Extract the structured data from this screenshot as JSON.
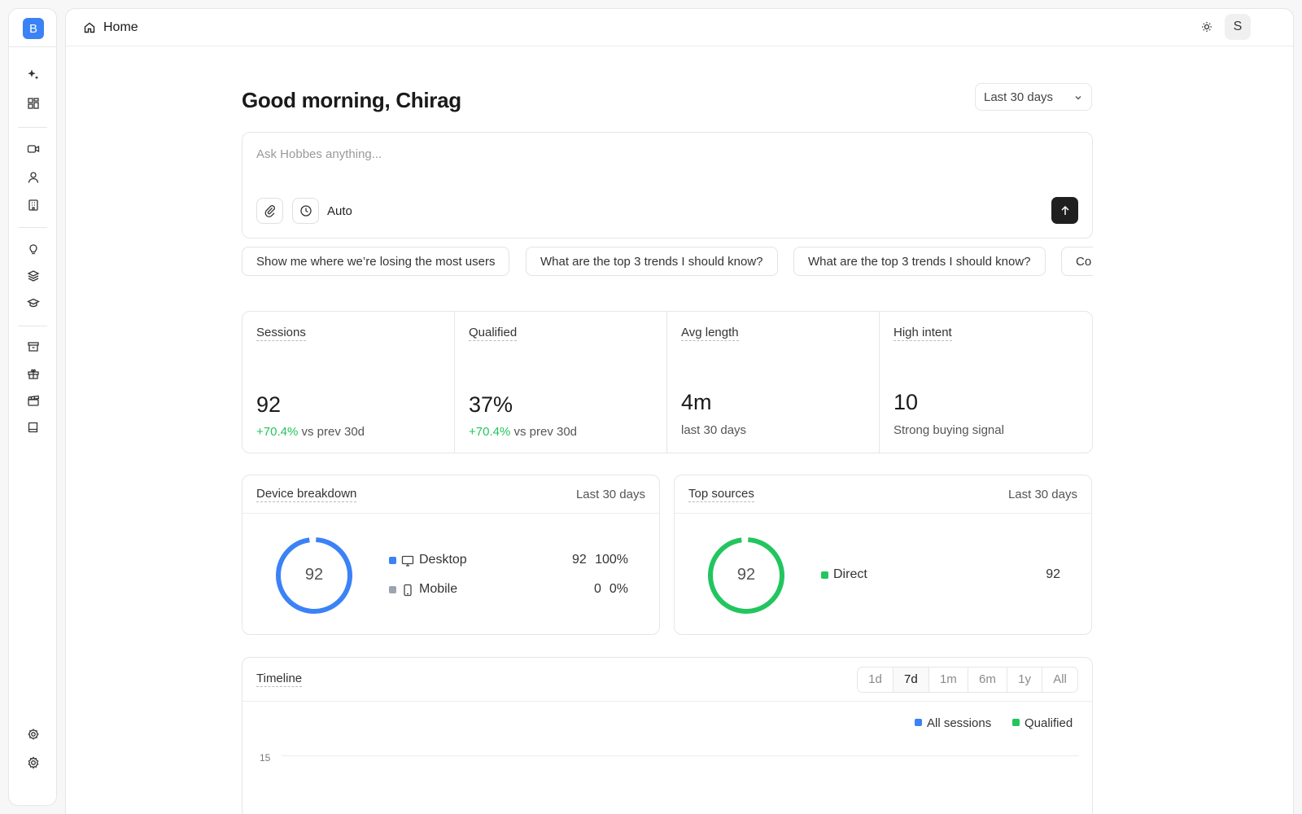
{
  "sidebar": {
    "logo": "B",
    "icons": [
      "sparkles-icon",
      "dashboard-icon",
      "video-icon",
      "user-icon",
      "building-icon",
      "lightbulb-icon",
      "layers-icon",
      "graduation-cap-icon",
      "archive-icon",
      "gift-icon",
      "clapperboard-icon",
      "book-icon",
      "settings-cog-icon",
      "gear-icon"
    ]
  },
  "topbar": {
    "breadcrumb": "Home",
    "avatar": "S"
  },
  "header": {
    "greeting": "Good morning, Chirag",
    "range": "Last 30 days"
  },
  "ask": {
    "placeholder": "Ask Hobbes anything...",
    "mode": "Auto"
  },
  "suggestions": [
    "Show me where we’re losing the most users",
    "What are the top 3 trends I should know?",
    "What are the top 3 trends I should know?",
    "Co"
  ],
  "stats": [
    {
      "label": "Sessions",
      "value": "92",
      "delta": "+70.4%",
      "sub": "vs prev 30d"
    },
    {
      "label": "Qualified",
      "value": "37%",
      "delta": "+70.4%",
      "sub": "vs prev 30d"
    },
    {
      "label": "Avg length",
      "value": "4m",
      "sub": "last 30 days"
    },
    {
      "label": "High intent",
      "value": "10",
      "sub": "Strong buying signal"
    }
  ],
  "device_breakdown": {
    "title": "Device breakdown",
    "range": "Last 30 days",
    "total": "92",
    "rows": [
      {
        "label": "Desktop",
        "count": "92",
        "pct": "100%",
        "color": "#3b82f6"
      },
      {
        "label": "Mobile",
        "count": "0",
        "pct": "0%",
        "color": "#9ca3af"
      }
    ]
  },
  "top_sources": {
    "title": "Top sources",
    "range": "Last 30 days",
    "total": "92",
    "rows": [
      {
        "label": "Direct",
        "count": "92",
        "color": "#22c55e"
      }
    ]
  },
  "timeline": {
    "title": "Timeline",
    "ranges": [
      "1d",
      "7d",
      "1m",
      "6m",
      "1y",
      "All"
    ],
    "active_range": "7d",
    "legend": [
      {
        "name": "All sessions",
        "color": "#3b82f6"
      },
      {
        "name": "Qualified",
        "color": "#22c55e"
      }
    ],
    "y_tick": "15"
  },
  "colors": {
    "accent": "#3b82f6",
    "positive": "#22c55e",
    "send_button": "#1f1f1f"
  }
}
